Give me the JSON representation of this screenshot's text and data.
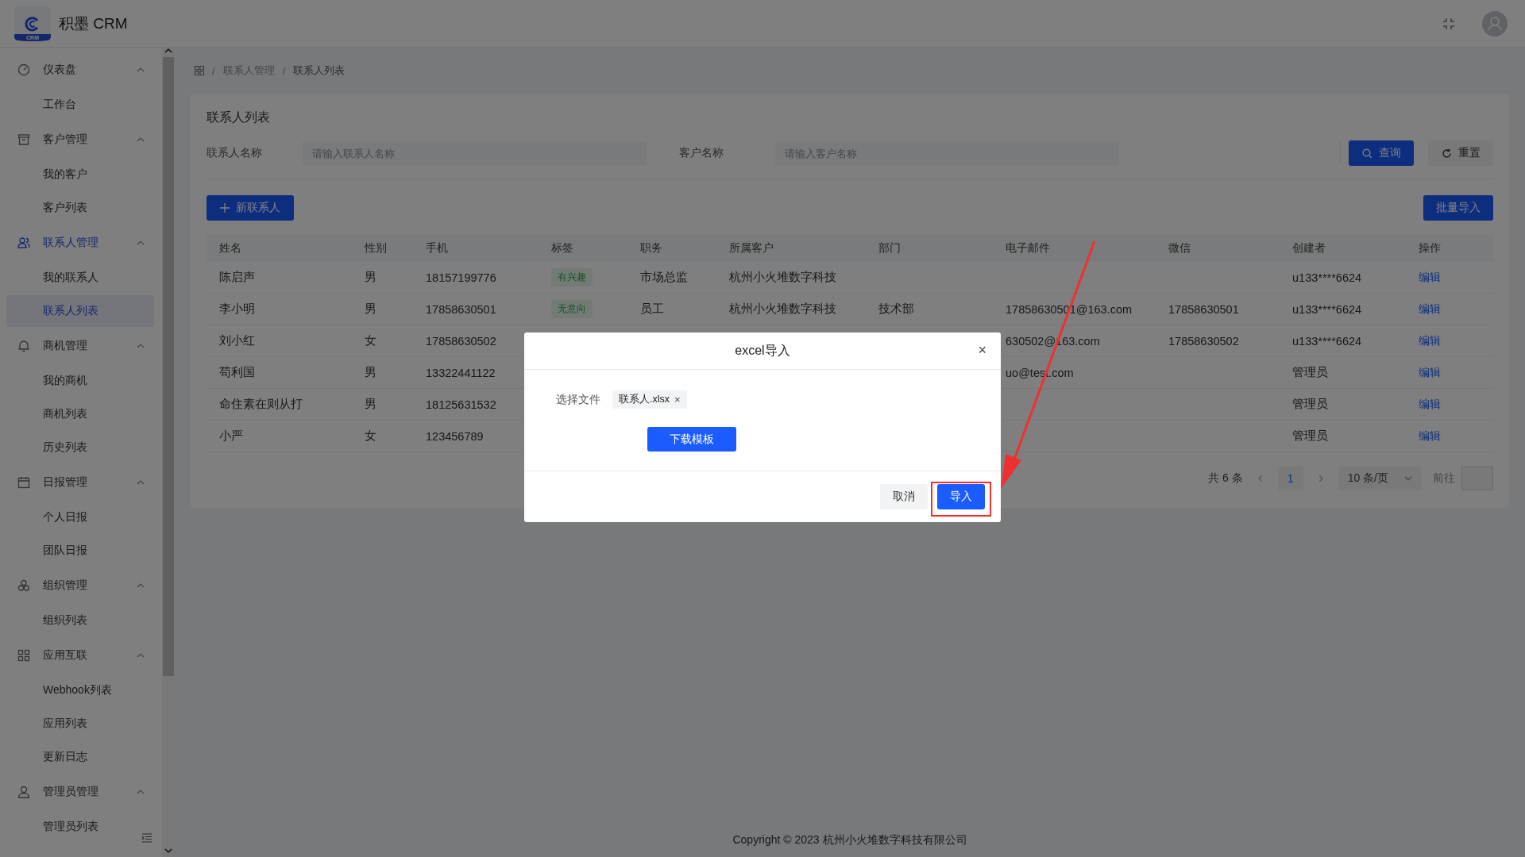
{
  "header": {
    "app_name": "积墨 CRM",
    "logo_text": "CRM"
  },
  "sidebar": {
    "groups": [
      {
        "label": "仪表盘",
        "expanded": true,
        "active": false,
        "children": [
          {
            "label": "工作台",
            "selected": false
          }
        ]
      },
      {
        "label": "客户管理",
        "expanded": true,
        "active": false,
        "children": [
          {
            "label": "我的客户",
            "selected": false
          },
          {
            "label": "客户列表",
            "selected": false
          }
        ]
      },
      {
        "label": "联系人管理",
        "expanded": true,
        "active": true,
        "children": [
          {
            "label": "我的联系人",
            "selected": false
          },
          {
            "label": "联系人列表",
            "selected": true
          }
        ]
      },
      {
        "label": "商机管理",
        "expanded": true,
        "active": false,
        "children": [
          {
            "label": "我的商机",
            "selected": false
          },
          {
            "label": "商机列表",
            "selected": false
          },
          {
            "label": "历史列表",
            "selected": false
          }
        ]
      },
      {
        "label": "日报管理",
        "expanded": true,
        "active": false,
        "children": [
          {
            "label": "个人日报",
            "selected": false
          },
          {
            "label": "团队日报",
            "selected": false
          }
        ]
      },
      {
        "label": "组织管理",
        "expanded": true,
        "active": false,
        "children": [
          {
            "label": "组织列表",
            "selected": false
          }
        ]
      },
      {
        "label": "应用互联",
        "expanded": true,
        "active": false,
        "children": [
          {
            "label": "Webhook列表",
            "selected": false
          },
          {
            "label": "应用列表",
            "selected": false
          },
          {
            "label": "更新日志",
            "selected": false
          }
        ]
      },
      {
        "label": "管理员管理",
        "expanded": true,
        "active": false,
        "children": [
          {
            "label": "管理员列表",
            "selected": false
          }
        ]
      }
    ]
  },
  "breadcrumb": [
    "联系人管理",
    "联系人列表"
  ],
  "breadcrumb_separator": "/",
  "card": {
    "title": "联系人列表",
    "filters": [
      {
        "label": "联系人名称",
        "placeholder": "请输入联系人名称"
      },
      {
        "label": "客户名称",
        "placeholder": "请输入客户名称"
      }
    ],
    "query_button": "查询",
    "reset_button": "重置",
    "new_button": "新联系人",
    "import_button": "批量导入"
  },
  "table": {
    "columns": [
      "姓名",
      "性别",
      "手机",
      "标签",
      "职务",
      "所属客户",
      "部门",
      "电子邮件",
      "微信",
      "创建者",
      "操作"
    ],
    "rows": [
      {
        "name": "陈启声",
        "gender": "男",
        "phone": "18157199776",
        "tag": "有兴趣",
        "title": "市场总监",
        "customer": "杭州小火堆数字科技",
        "creator": "u133****6624",
        "action": "编辑"
      },
      {
        "name": "李小明",
        "gender": "男",
        "phone": "17858630501",
        "tag": "无意向",
        "title": "员工",
        "customer": "杭州小火堆数字科技",
        "dept": "技术部",
        "email": "17858630501@163.com",
        "wechat": "17858630501",
        "creator": "u133****6624",
        "action": "编辑"
      },
      {
        "name": "刘小红",
        "gender": "女",
        "phone": "17858630502",
        "email": "630502@163.com",
        "wechat": "17858630502",
        "creator": "u133****6624",
        "action": "编辑"
      },
      {
        "name": "苟利国",
        "gender": "男",
        "phone": "13322441122",
        "email": "uo@test.com",
        "creator": "管理员",
        "action": "编辑"
      },
      {
        "name": "命住素在则从打",
        "gender": "男",
        "phone": "18125631532",
        "creator": "管理员",
        "action": "编辑"
      },
      {
        "name": "小严",
        "gender": "女",
        "phone": "123456789",
        "creator": "管理员",
        "action": "编辑"
      }
    ]
  },
  "pagination": {
    "total": "共 6 条",
    "pages": [
      {
        "label": "1",
        "selected": true
      }
    ],
    "page_size": "10 条/页",
    "goto_label": "前往"
  },
  "footer": "Copyright © 2023 杭州小火堆数字科技有限公司",
  "dialog": {
    "title": "excel导入",
    "close": "×",
    "file_label": "选择文件",
    "file_name": "联系人.xlsx",
    "file_remove": "×",
    "template_button": "下载模板",
    "cancel_button": "取消",
    "confirm_button": "导入"
  }
}
